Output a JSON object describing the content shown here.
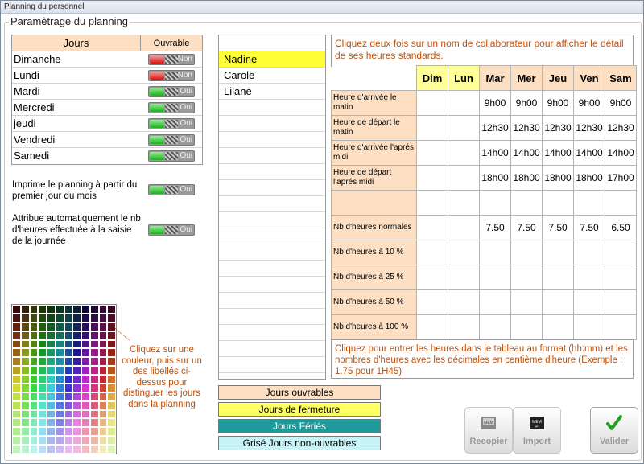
{
  "window": {
    "title": "Planning du personnel"
  },
  "group_title": "Paramètrage du planning",
  "days_table": {
    "col_days": "Jours",
    "col_open": "Ouvrable",
    "rows": [
      {
        "day": "Dimanche",
        "open": false,
        "toggle_text": "Non"
      },
      {
        "day": "Lundi",
        "open": false,
        "toggle_text": "Non"
      },
      {
        "day": "Mardi",
        "open": true,
        "toggle_text": "Oui"
      },
      {
        "day": "Mercredi",
        "open": true,
        "toggle_text": "Oui"
      },
      {
        "day": "jeudi",
        "open": true,
        "toggle_text": "Oui"
      },
      {
        "day": "Vendredi",
        "open": true,
        "toggle_text": "Oui"
      },
      {
        "day": "Samedi",
        "open": true,
        "toggle_text": "Oui"
      }
    ]
  },
  "options": [
    {
      "label": "Imprime le planning à partir du premier jour du mois",
      "toggle_text": "Oui",
      "on": true
    },
    {
      "label": "Attribue automatiquement le nb d'heures effectuée à la saisie de la journée",
      "toggle_text": "Oui",
      "on": true
    }
  ],
  "palette_help": "Cliquez sur une couleur, puis sur un des libellés ci-dessus pour distinguer les jours dans la planning",
  "collaborators": [
    "Nadine",
    "Carole",
    "Lilane"
  ],
  "legend": [
    {
      "label": "Jours ouvrables",
      "color": "#fde0c4",
      "text_color": "#000000"
    },
    {
      "label": "Jours de fermeture",
      "color": "#ffff66",
      "text_color": "#000000"
    },
    {
      "label": "Jours Fériés",
      "color": "#1f9a9a",
      "text_color": "#ffffff"
    },
    {
      "label": "Grisé Jours non-ouvrables",
      "color": "#c8f4f7",
      "text_color": "#000000"
    }
  ],
  "info_top": "Cliquez deux fois sur un nom de collaborateur pour afficher le détail de ses heures standards.",
  "info_bottom": "Cliquez pour entrer les heures dans le tableau au format (hh:mm) et les nombres d'heures avec les décimales en centième d'heure (Exemple : 1.75 pour 1H45)",
  "schedule": {
    "days": [
      "Dim",
      "Lun",
      "Mar",
      "Mer",
      "Jeu",
      "Ven",
      "Sam"
    ],
    "rows": [
      {
        "label": "Heure d'arrivée le matin",
        "values": [
          "",
          "",
          "9h00",
          "9h00",
          "9h00",
          "9h00",
          "9h00"
        ]
      },
      {
        "label": "Heure de départ le matin",
        "values": [
          "",
          "",
          "12h30",
          "12h30",
          "12h30",
          "12h30",
          "12h30"
        ]
      },
      {
        "label": "Heure d'arrivée l'aprés midi",
        "values": [
          "",
          "",
          "14h00",
          "14h00",
          "14h00",
          "14h00",
          "14h00"
        ]
      },
      {
        "label": "Heure de départ l'aprés midi",
        "values": [
          "",
          "",
          "18h00",
          "18h00",
          "18h00",
          "18h00",
          "17h00"
        ]
      },
      {
        "label": "",
        "values": [
          "",
          "",
          "",
          "",
          "",
          "",
          ""
        ]
      },
      {
        "label": "Nb d'heures normales",
        "values": [
          "",
          "",
          "7.50",
          "7.50",
          "7.50",
          "7.50",
          "6.50"
        ]
      },
      {
        "label": "Nb d'heures à 10 %",
        "values": [
          "",
          "",
          "",
          "",
          "",
          "",
          ""
        ]
      },
      {
        "label": "Nb d'heures à 25 %",
        "values": [
          "",
          "",
          "",
          "",
          "",
          "",
          ""
        ]
      },
      {
        "label": "Nb d'heures à 50 %",
        "values": [
          "",
          "",
          "",
          "",
          "",
          "",
          ""
        ]
      },
      {
        "label": "Nb d'heures à 100 %",
        "values": [
          "",
          "",
          "",
          "",
          "",
          "",
          ""
        ]
      }
    ]
  },
  "buttons": {
    "copy": "Recopier",
    "import": "Import",
    "validate": "Valider"
  }
}
